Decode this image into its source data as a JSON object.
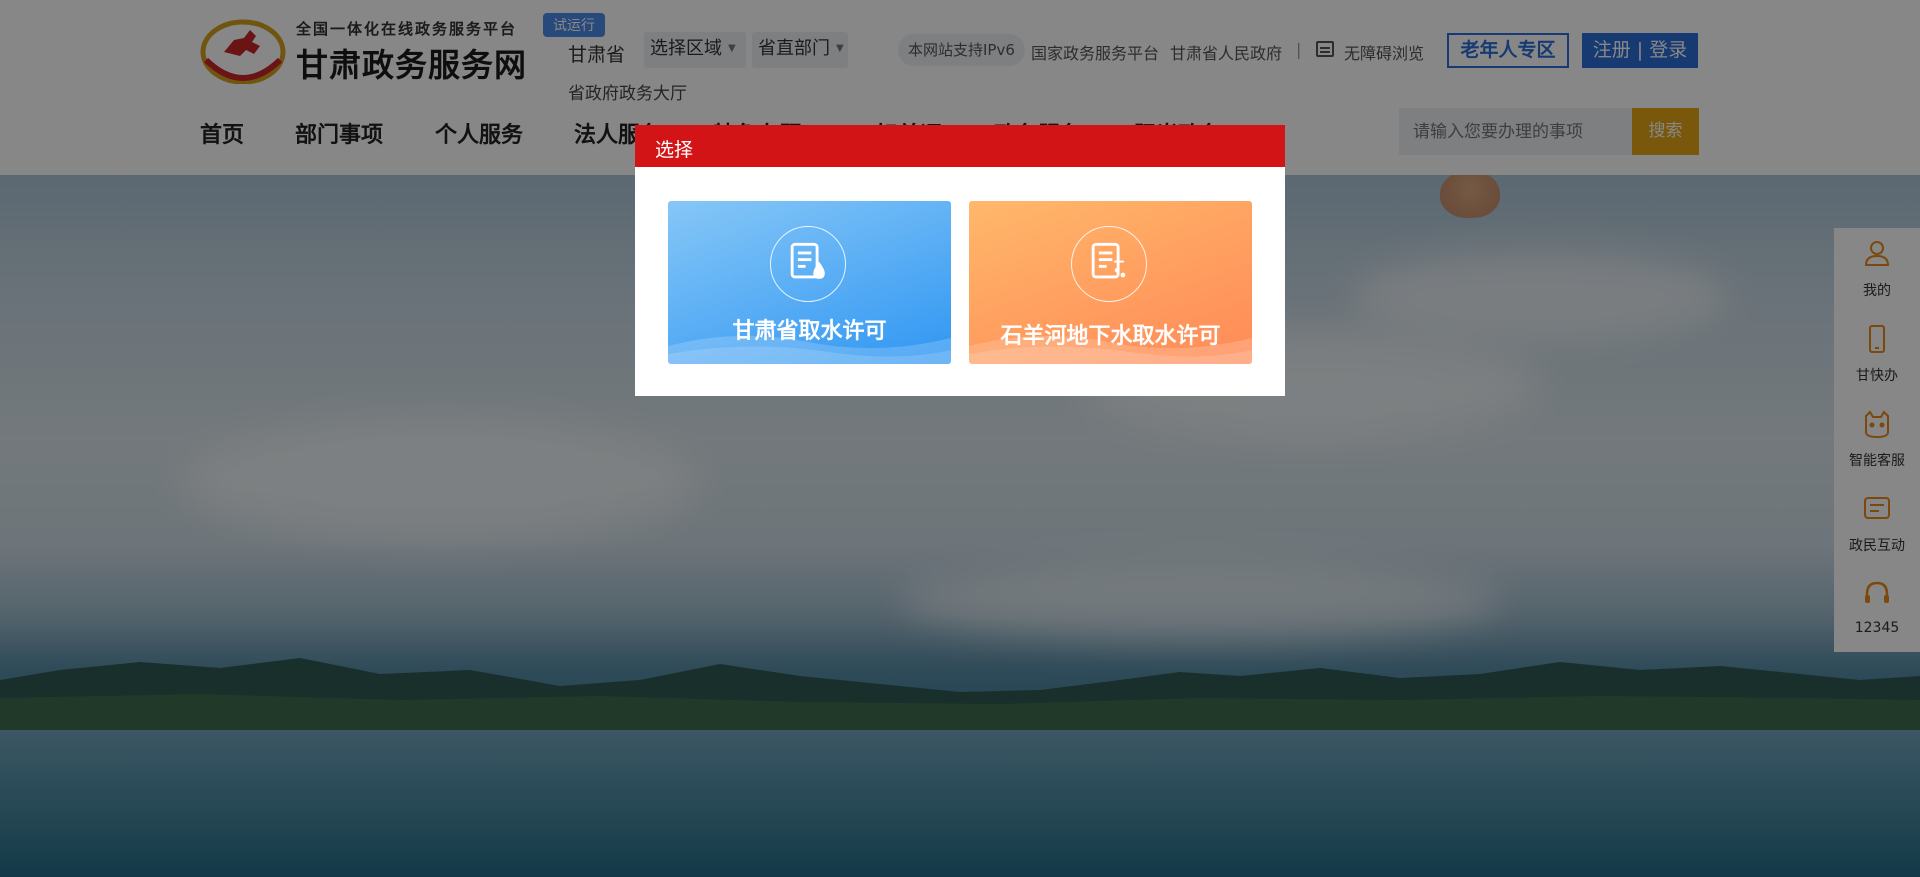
{
  "header": {
    "logo_sub": "全国一体化在线政务服务平台",
    "logo_main": "甘肃政务服务网",
    "trial_badge": "试运行",
    "region_label": "甘肃省",
    "region_select": "选择区域",
    "dept_select": "省直部门",
    "hall_link": "省政府政务大厅",
    "ipv6_badge": "本网站支持IPv6",
    "national_link": "国家政务服务平台",
    "province_link": "甘肃省人民政府",
    "separator": "|",
    "accessibility_link": "无障碍浏览",
    "elder_button": "老年人专区",
    "register": "注册",
    "auth_sep": "|",
    "login": "登录"
  },
  "nav": {
    "items": [
      "首页",
      "部门事项",
      "个人服务",
      "法人服务",
      "特色专题",
      "好差评",
      "政务服务",
      "阳光政务"
    ]
  },
  "search": {
    "placeholder": "请输入您要办理的事项",
    "button": "搜索"
  },
  "float_bar": {
    "items": [
      "我的",
      "甘快办",
      "智能客服",
      "政民互动",
      "12345"
    ]
  },
  "modal": {
    "title": "选择",
    "options": [
      "甘肃省取水许可",
      "石羊河地下水取水许可"
    ]
  },
  "colors": {
    "brand_red": "#d21416",
    "brand_blue": "#2a6fd6",
    "search_gold": "#e4a415",
    "card_blue": "#4aa6f4",
    "card_orange": "#ffa060",
    "float_orange": "#e88a1a"
  }
}
